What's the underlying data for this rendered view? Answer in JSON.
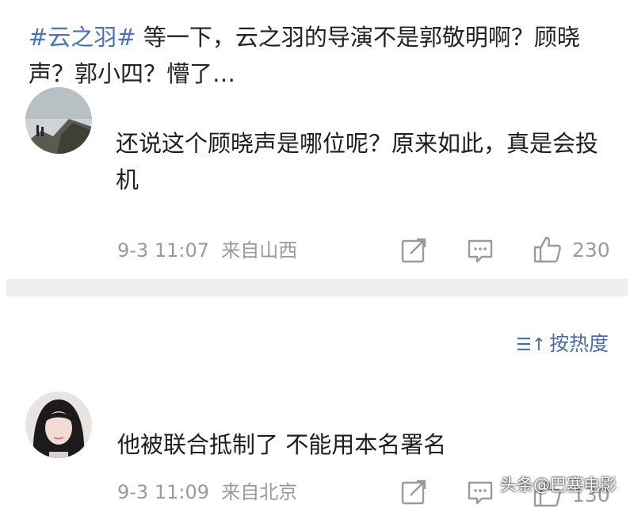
{
  "post": {
    "hashtag": "#云之羽#",
    "text": " 等一下，云之羽的导演不是郭敬明啊？顾晓声？郭小四？懵了…"
  },
  "comments": [
    {
      "text": "还说这个顾晓声是哪位呢？原来如此，真是会投机",
      "time": "9-3 11:07",
      "location": "来自山西",
      "likes": "230",
      "avatar_icon": "landscape-avatar"
    },
    {
      "text": "他被联合抵制了 不能用本名署名",
      "time": "9-3 11:09",
      "location": "来自北京",
      "likes": "130",
      "avatar_icon": "girl-avatar"
    }
  ],
  "sort": {
    "icon": "sort-icon",
    "label": "按热度"
  },
  "watermark": "头条@巴塞电影",
  "colors": {
    "hashtag": "#4a74b8",
    "meta": "#9a9a9a",
    "sort": "#4a6fa5",
    "divider": "#efefef"
  }
}
